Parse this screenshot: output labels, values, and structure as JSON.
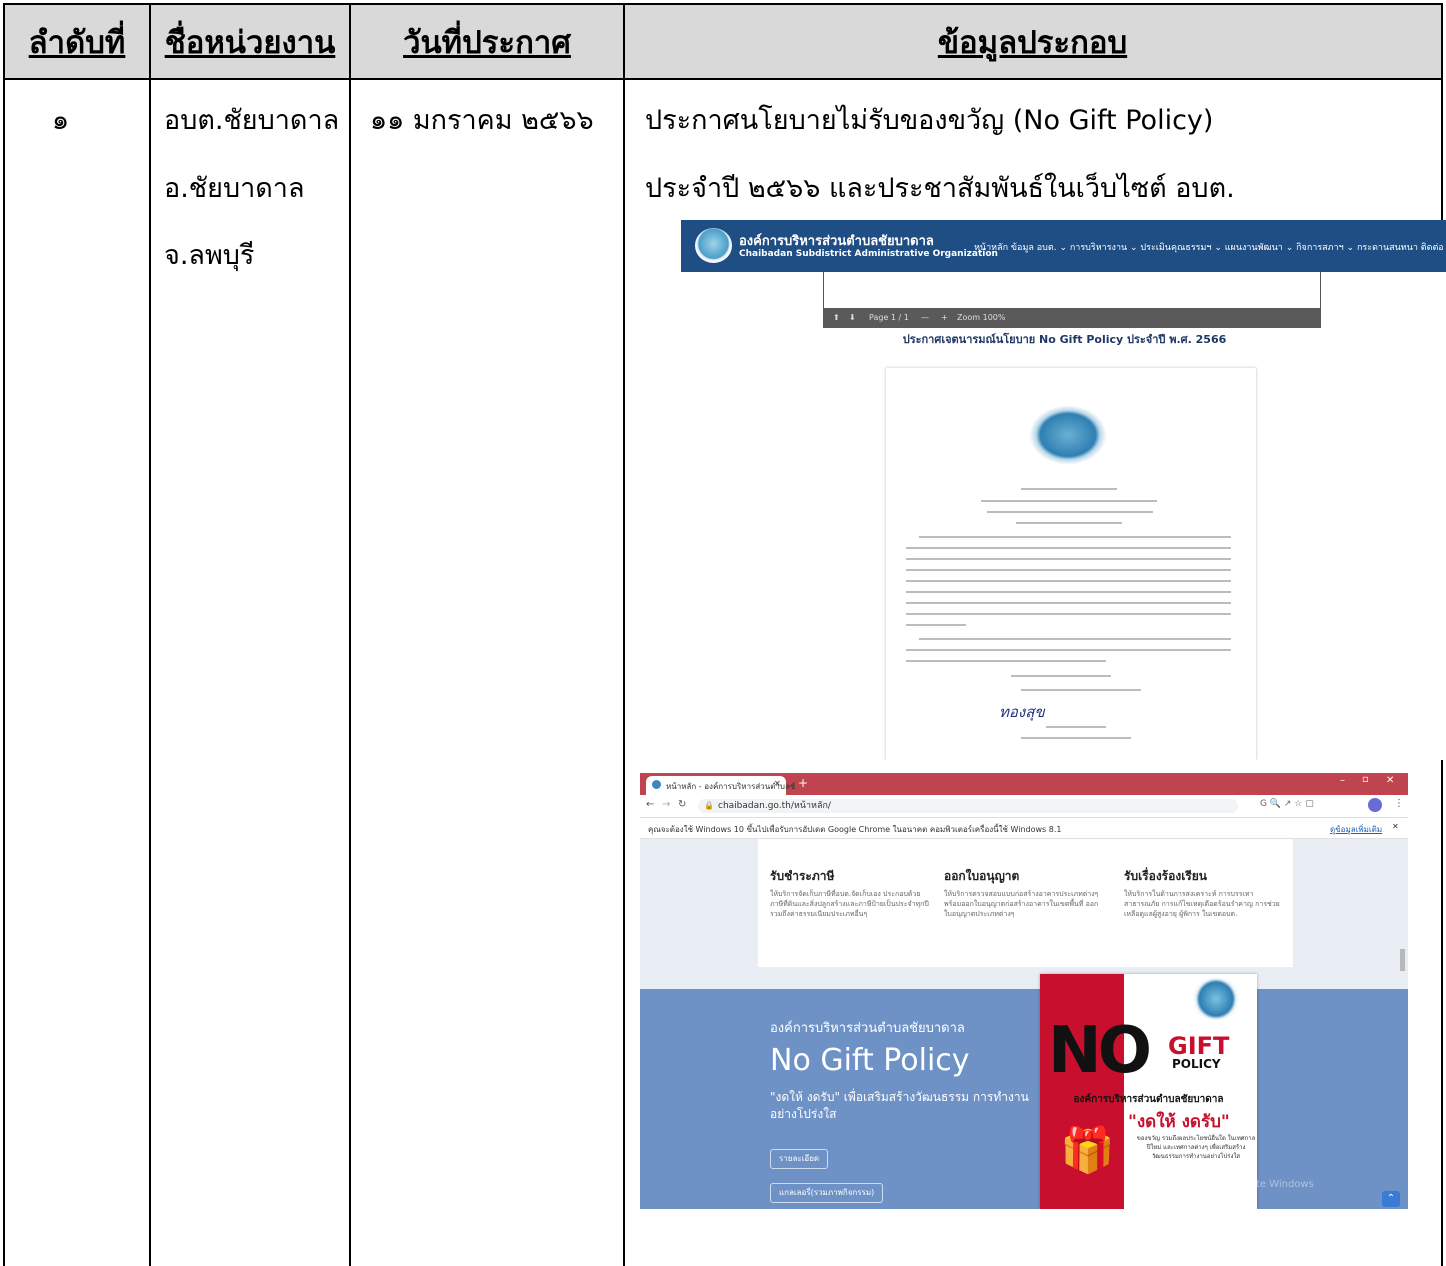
{
  "table": {
    "headers": [
      "ลำดับที่",
      "ชื่อหน่วยงาน",
      "วันที่ประกาศ",
      "ข้อมูลประกอบ"
    ],
    "row": {
      "no": "๑",
      "agency": [
        "อบต.ชัยบาดาล",
        "อ.ชัยบาดาล",
        "จ.ลพบุรี"
      ],
      "date": "๑๑ มกราคม ๒๕๖๖",
      "info_line1": "ประกาศนโยบายไม่รับของขวัญ (No Gift Policy)",
      "info_line2": "ประจำปี ๒๕๖๖ และประชาสัมพันธ์ในเว็บไซต์ อบต."
    }
  },
  "screenshot1": {
    "site_title": "องค์การบริหารส่วนตำบลชัยบาดาล",
    "site_subtitle": "Chaibadan Subdistrict Administrative Organization",
    "menu": "หน้าหลัก  ข้อมูล อบต. ⌄  การบริหารงาน ⌄  ประเมินคุณธรรมฯ ⌄  แผนงานพัฒนา ⌄  กิจการสภาฯ ⌄  กระดานสนทนา  ติดต่อ",
    "viewer_page": "Page 1 / 1",
    "viewer_zoom": "Zoom 100%",
    "doc_heading": "ประกาศเจตนารมณ์นโยบาย No Gift Policy ประจำปี พ.ศ. 2566",
    "signature": "ทองสุข"
  },
  "screenshot2": {
    "tab_title": "หน้าหลัก - องค์การบริหารส่วนตำบลชั",
    "url": "chaibadan.go.th/หน้าหลัก/",
    "info_bar": "คุณจะต้องใช้ Windows 10 ขึ้นไปเพื่อรับการอัปเดต Google Chrome ในอนาคต คอมพิวเตอร์เครื่องนี้ใช้ Windows 8.1",
    "info_link": "ดูข้อมูลเพิ่มเติม",
    "cards": [
      {
        "title": "รับชำระภาษี",
        "desc": "ให้บริการจัดเก็บภาษีที่อบต.จัดเก็บเอง ประกอบด้วย ภาษีที่ดินและสิ่งปลูกสร้างและภาษีป้ายเป็นประจำทุกปี รวมถึงค่าธรรมเนียมประเภทอื่นๆ"
      },
      {
        "title": "ออกใบอนุญาต",
        "desc": "ให้บริการตรวจสอบแบบก่อสร้างอาคารประเภทต่างๆ พร้อมออกใบอนุญาตก่อสร้างอาคารในเขตพื้นที่ ออกใบอนุญาตประเภทต่างๆ"
      },
      {
        "title": "รับเรื่องร้องเรียน",
        "desc": "ให้บริการในด้านการสงเคราะห์ การบรรเทาสาธารณภัย การแก้ไขเหตุเดือดร้อนรำคาญ การช่วยเหลือดูแลผู้สูงอายุ ผู้พิการ ในเขตอบต."
      }
    ],
    "org": "องค์การบริหารส่วนตำบลชัยบาดาล",
    "headline": "No Gift Policy",
    "slogan": "\"งดให้ งดรับ\" เพื่อเสริมสร้างวัฒนธรรม การทำงานอย่างโปร่งใส",
    "btn1": "รายละเอียด",
    "btn2": "แกลเลอรี่(รวมภาพกิจกรรม)",
    "poster": {
      "no": "NO",
      "gift": "GIFT",
      "policy": "POLICY",
      "org": "องค์การบริหารส่วนตำบลชัยบาดาล",
      "slogan": "\"งดให้ งดรับ\"",
      "small": "ของขวัญ รวมถึงผลประโยชน์อื่นใด ในเทศกาลปีใหม่ และเทศกาลต่างๆ เพื่อเสริมสร้างวัฒนธรรมการทำงานอย่างโปร่งใส"
    },
    "watermark": "Activate Windows"
  }
}
